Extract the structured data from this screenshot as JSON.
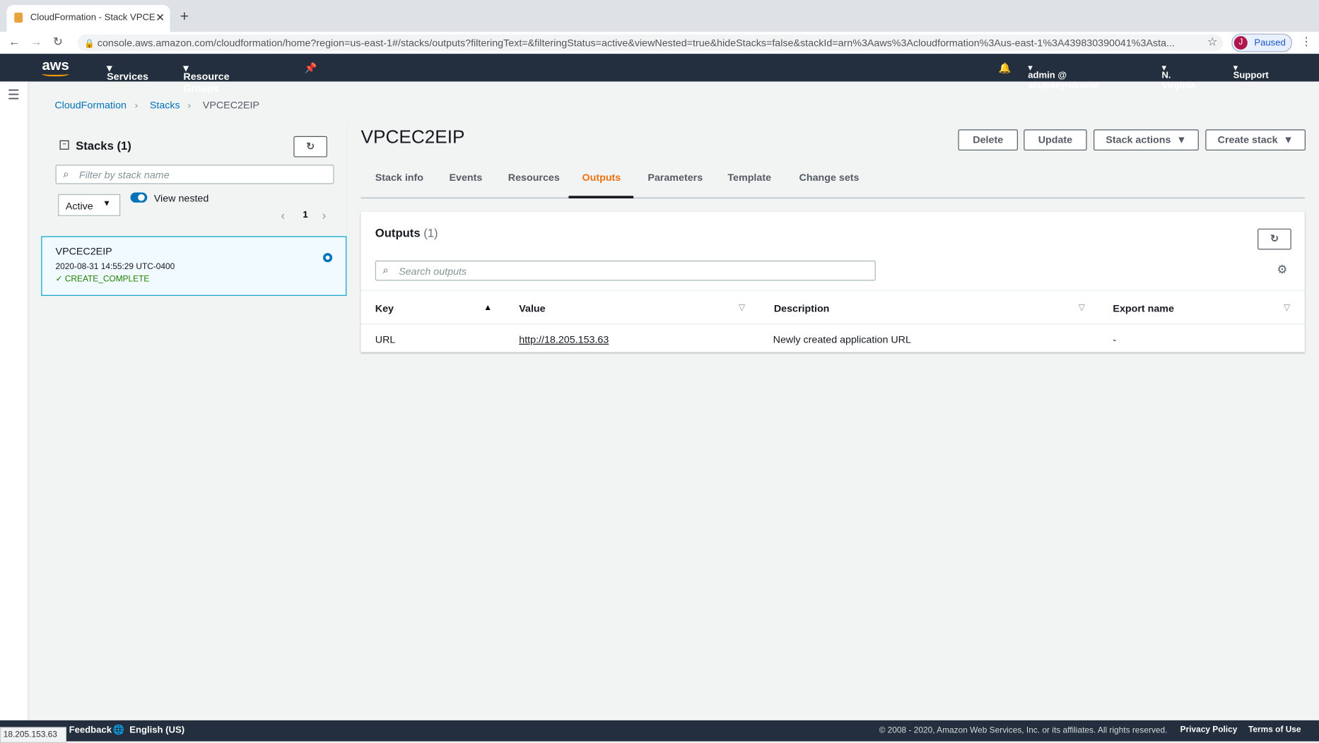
{
  "browser": {
    "tab_title": "CloudFormation - Stack VPCE",
    "url": "console.aws.amazon.com/cloudformation/home?region=us-east-1#/stacks/outputs?filteringText=&filteringStatus=active&viewNested=true&hideStacks=false&stackId=arn%3Aaws%3Acloudformation%3Aus-east-1%3A439830390041%3Asta...",
    "profile_initial": "J",
    "profile_status": "Paused",
    "status_url": "18.205.153.63"
  },
  "nav": {
    "logo": "aws",
    "services": "Services",
    "resource_groups": "Resource Groups",
    "user": "admin @ scubasyndrome",
    "region": "N. Virginia",
    "support": "Support"
  },
  "breadcrumb": [
    "CloudFormation",
    "Stacks",
    "VPCEC2EIP"
  ],
  "stacks": {
    "title": "Stacks",
    "count": "(1)",
    "filter_placeholder": "Filter by stack name",
    "status_filter": "Active",
    "view_nested": "View nested",
    "page": "1",
    "items": [
      {
        "name": "VPCEC2EIP",
        "date": "2020-08-31 14:55:29 UTC-0400",
        "status": "CREATE_COMPLETE"
      }
    ]
  },
  "stack": {
    "title": "VPCEC2EIP",
    "buttons": {
      "delete": "Delete",
      "update": "Update",
      "actions": "Stack actions",
      "create": "Create stack"
    },
    "tabs": [
      "Stack info",
      "Events",
      "Resources",
      "Outputs",
      "Parameters",
      "Template",
      "Change sets"
    ],
    "active_tab": "Outputs"
  },
  "outputs": {
    "title": "Outputs",
    "count": "(1)",
    "search_placeholder": "Search outputs",
    "columns": [
      "Key",
      "Value",
      "Description",
      "Export name"
    ],
    "rows": [
      {
        "key": "URL",
        "value": "http://18.205.153.63",
        "description": "Newly created application URL",
        "export": "-"
      }
    ]
  },
  "footer": {
    "feedback": "Feedback",
    "language": "English (US)",
    "copyright": "© 2008 - 2020, Amazon Web Services, Inc. or its affiliates. All rights reserved.",
    "privacy": "Privacy Policy",
    "terms": "Terms of Use"
  },
  "colors": {
    "accent": "#ec7211",
    "link": "#0073bb",
    "success": "#1d8102",
    "nav": "#232f3e"
  }
}
